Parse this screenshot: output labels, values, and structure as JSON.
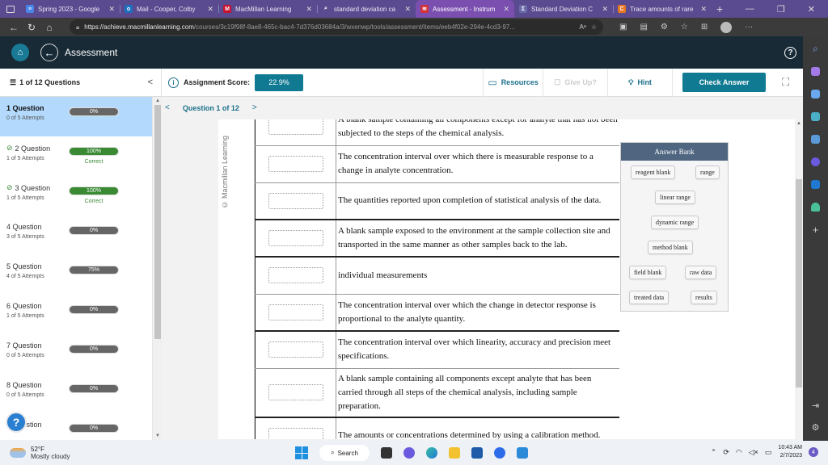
{
  "browser": {
    "tabs": [
      {
        "title": "Spring 2023 - Google",
        "icon": "google-docs-icon",
        "color": "#4a86e8",
        "glyph": "≡",
        "active": false
      },
      {
        "title": "Mail - Cooper, Colby",
        "icon": "outlook-icon",
        "color": "#1f6fbf",
        "glyph": "o",
        "active": false
      },
      {
        "title": "MacMillan Learning",
        "icon": "macmillan-icon",
        "color": "#c8102e",
        "glyph": "M",
        "active": false
      },
      {
        "title": "standard deviation ca",
        "icon": "search-icon",
        "color": "#5a4a8f",
        "glyph": "⌕",
        "active": false
      },
      {
        "title": "Assessment - Instrum",
        "icon": "assessment-icon",
        "color": "#d4323a",
        "glyph": "≋",
        "active": true
      },
      {
        "title": "Standard Deviation C",
        "icon": "sigma-icon",
        "color": "#6a6aa8",
        "glyph": "Σ",
        "active": false
      },
      {
        "title": "Trace amounts of rare",
        "icon": "chegg-icon",
        "color": "#e87722",
        "glyph": "C",
        "active": false
      }
    ],
    "new_tab": "+",
    "url_host": "https://achieve.macmillanlearning.com",
    "url_path": "/courses/3c19f98f-8ae8-465c-bac4-7d376d03684a/3/wxenwp/tools/assessment/items/eeb4f02e-294e-4cd3-97...",
    "read_aloud": "Aᵃ"
  },
  "app": {
    "title": "Assessment",
    "question_count": "1 of 12 Questions",
    "score_label": "Assignment Score:",
    "score_value": "22.9%",
    "resources": "Resources",
    "give_up": "Give Up?",
    "hint": "Hint",
    "check_answer": "Check Answer",
    "question_nav": "Question 1 of 12",
    "watermark": "© Macmillan Learning"
  },
  "questions": [
    {
      "name": "1 Question",
      "attempts": "0 of 5 Attempts",
      "score": "0%",
      "status": "",
      "checked": false,
      "active": true
    },
    {
      "name": "2 Question",
      "attempts": "1 of 5 Attempts",
      "score": "100%",
      "status": "Correct",
      "checked": true,
      "active": false
    },
    {
      "name": "3 Question",
      "attempts": "1 of 5 Attempts",
      "score": "100%",
      "status": "Correct",
      "checked": true,
      "active": false
    },
    {
      "name": "4 Question",
      "attempts": "3 of 5 Attempts",
      "score": "0%",
      "status": "",
      "checked": false,
      "active": false
    },
    {
      "name": "5 Question",
      "attempts": "4 of 5 Attempts",
      "score": "75%",
      "status": "",
      "checked": false,
      "active": false
    },
    {
      "name": "6 Question",
      "attempts": "1 of 5 Attempts",
      "score": "0%",
      "status": "",
      "checked": false,
      "active": false
    },
    {
      "name": "7 Question",
      "attempts": "0 of 5 Attempts",
      "score": "0%",
      "status": "",
      "checked": false,
      "active": false
    },
    {
      "name": "8 Question",
      "attempts": "0 of 5 Attempts",
      "score": "0%",
      "status": "",
      "checked": false,
      "active": false
    },
    {
      "name": "9 Question",
      "attempts": "",
      "score": "0%",
      "status": "",
      "checked": false,
      "active": false
    }
  ],
  "definitions": [
    {
      "text": "A blank sample containing all components except for analyte that has not been subjected to the steps of the chemical analysis.",
      "thick": false
    },
    {
      "text": "The concentration interval over which there is measurable response to a change in analyte concentration.",
      "thick": false
    },
    {
      "text": "The quantities reported upon completion of statistical analysis of the data.",
      "thick": true
    },
    {
      "text": "A blank sample exposed to the environment at the sample collection site and transported in the same manner as other samples back to the lab.",
      "thick": true
    },
    {
      "text": "individual measurements",
      "thick": false
    },
    {
      "text": "The concentration interval over which the change in detector response is proportional to the analyte quantity.",
      "thick": true
    },
    {
      "text": "The concentration interval over which linearity, accuracy and precision meet specifications.",
      "thick": false
    },
    {
      "text": "A blank sample containing all components except analyte that has been carried through all steps of the chemical analysis, including sample preparation.",
      "thick": true
    },
    {
      "text": "The amounts or concentrations determined by using a calibration method.",
      "thick": false
    }
  ],
  "answer_bank": {
    "title": "Answer Bank",
    "items": [
      "reagent blank",
      "range",
      "linear range",
      "dynamic range",
      "method blank",
      "field blank",
      "raw data",
      "treated data",
      "results"
    ]
  },
  "taskbar": {
    "temperature": "52°F",
    "weather": "Mostly cloudy",
    "search": "Search",
    "time": "10:43 AM",
    "date": "2/7/2023",
    "notifications": "4"
  }
}
